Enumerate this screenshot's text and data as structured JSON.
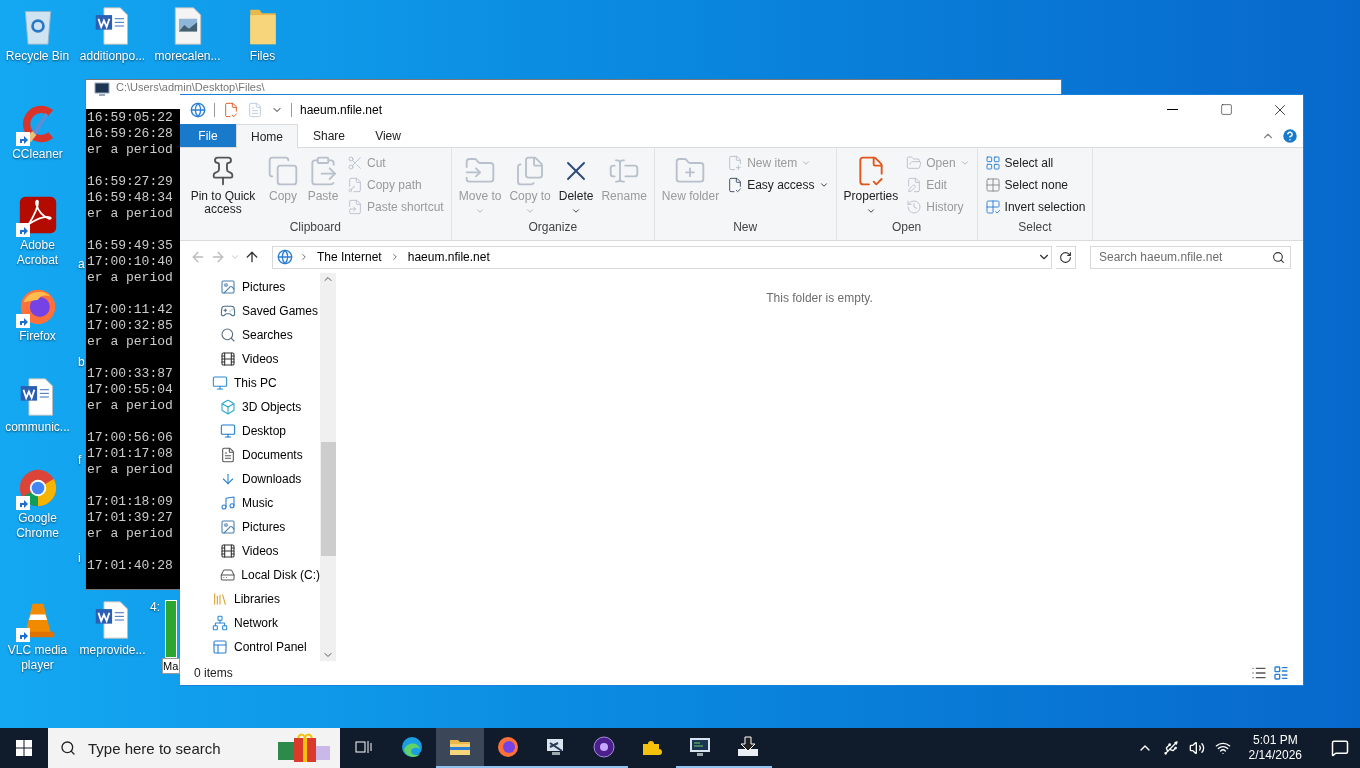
{
  "desktop": {
    "top_row": [
      {
        "label": "Recycle Bin",
        "kind": "recycle",
        "shortcut": false
      },
      {
        "label": "additionpo...",
        "kind": "word",
        "shortcut": false
      },
      {
        "label": "morecalen...",
        "kind": "image",
        "shortcut": false
      },
      {
        "label": "Files",
        "kind": "folder",
        "shortcut": false
      }
    ],
    "left_column": [
      {
        "label": "CCleaner",
        "kind": "ccleaner",
        "shortcut": true
      },
      {
        "label": "Adobe Acrobat",
        "kind": "acrobat",
        "shortcut": true
      },
      {
        "label": "Firefox",
        "kind": "firefox",
        "shortcut": true
      },
      {
        "label": "communic...",
        "kind": "word",
        "shortcut": false
      },
      {
        "label": "Google Chrome",
        "kind": "chrome",
        "shortcut": true
      }
    ],
    "bottom_row": [
      {
        "label": "VLC media player",
        "kind": "vlc",
        "shortcut": true
      },
      {
        "label": "meprovide...",
        "kind": "word",
        "shortcut": false
      },
      {
        "label": "4:",
        "kind": "covered"
      }
    ],
    "covered_labels": [
      "a",
      "b",
      "f",
      "i"
    ]
  },
  "back_window": {
    "label": "Ma"
  },
  "console": {
    "title": "C:\\Users\\admin\\Desktop\\Files\\",
    "blocks": [
      [
        "16:59:05:22",
        "16:59:26:28",
        "er a period"
      ],
      [
        "16:59:27:29",
        "16:59:48:34",
        "er a period"
      ],
      [
        "16:59:49:35",
        "17:00:10:40",
        "er a period"
      ],
      [
        "17:00:11:42",
        "17:00:32:85",
        "er a period"
      ],
      [
        "17:00:33:87",
        "17:00:55:04",
        "er a period"
      ],
      [
        "17:00:56:06",
        "17:01:17:08",
        "er a period"
      ],
      [
        "17:01:18:09",
        "17:01:39:27",
        "er a period"
      ],
      [
        "17:01:40:28"
      ]
    ]
  },
  "explorer": {
    "title": "haeum.nfile.net",
    "tabs": [
      {
        "label": "File",
        "kind": "menu",
        "selected": false
      },
      {
        "label": "Home",
        "kind": "tab",
        "selected": true
      },
      {
        "label": "Share",
        "kind": "tab",
        "selected": false
      },
      {
        "label": "View",
        "kind": "tab",
        "selected": false
      }
    ],
    "ribbon": [
      {
        "label": "Clipboard",
        "buttons": [
          {
            "label": "Pin to Quick access",
            "kind": "large",
            "disabled": false,
            "dropdown": false
          },
          {
            "label": "Copy",
            "kind": "large",
            "disabled": true,
            "dropdown": false
          },
          {
            "label": "Paste",
            "kind": "large",
            "disabled": true,
            "dropdown": false
          },
          {
            "label": "Cut",
            "kind": "small",
            "disabled": true,
            "dropdown": false
          },
          {
            "label": "Copy path",
            "kind": "small",
            "disabled": true,
            "dropdown": false
          },
          {
            "label": "Paste shortcut",
            "kind": "small",
            "disabled": true,
            "dropdown": false
          }
        ]
      },
      {
        "label": "Organize",
        "buttons": [
          {
            "label": "Move to",
            "kind": "large",
            "disabled": true,
            "dropdown": true
          },
          {
            "label": "Copy to",
            "kind": "large",
            "disabled": true,
            "dropdown": true
          },
          {
            "label": "Delete",
            "kind": "large",
            "disabled": false,
            "dropdown": true
          },
          {
            "label": "Rename",
            "kind": "large",
            "disabled": true,
            "dropdown": false
          }
        ]
      },
      {
        "label": "New",
        "buttons": [
          {
            "label": "New folder",
            "kind": "large",
            "disabled": true,
            "dropdown": false
          },
          {
            "label": "New item",
            "kind": "small",
            "disabled": true,
            "dropdown": true
          },
          {
            "label": "Easy access",
            "kind": "small",
            "disabled": false,
            "dropdown": true
          }
        ]
      },
      {
        "label": "Open",
        "buttons": [
          {
            "label": "Properties",
            "kind": "large",
            "disabled": false,
            "dropdown": true
          },
          {
            "label": "Open",
            "kind": "small",
            "disabled": true,
            "dropdown": true
          },
          {
            "label": "Edit",
            "kind": "small",
            "disabled": true,
            "dropdown": false
          },
          {
            "label": "History",
            "kind": "small",
            "disabled": true,
            "dropdown": false
          }
        ]
      },
      {
        "label": "Select",
        "buttons": [
          {
            "label": "Select all",
            "kind": "small",
            "disabled": false,
            "dropdown": false
          },
          {
            "label": "Select none",
            "kind": "small",
            "disabled": false,
            "dropdown": false
          },
          {
            "label": "Invert selection",
            "kind": "small",
            "disabled": false,
            "dropdown": false
          }
        ]
      }
    ],
    "address": [
      "The Internet",
      "haeum.nfile.net"
    ],
    "search": {
      "placeholder": "Search haeum.nfile.net"
    },
    "nav": [
      {
        "children": [
          {
            "label": "Pictures",
            "kind": "pictures"
          },
          {
            "label": "Saved Games",
            "kind": "games"
          },
          {
            "label": "Searches",
            "kind": "search"
          },
          {
            "label": "Videos",
            "kind": "videos"
          }
        ]
      },
      {
        "label": "This PC",
        "kind": "pc",
        "children": [
          {
            "label": "3D Objects",
            "kind": "objects"
          },
          {
            "label": "Desktop",
            "kind": "desktop"
          },
          {
            "label": "Documents",
            "kind": "documents"
          },
          {
            "label": "Downloads",
            "kind": "downloads"
          },
          {
            "label": "Music",
            "kind": "music"
          },
          {
            "label": "Pictures",
            "kind": "pictures"
          },
          {
            "label": "Videos",
            "kind": "videos"
          },
          {
            "label": "Local Disk (C:)",
            "kind": "disk"
          }
        ]
      },
      {
        "label": "Libraries",
        "kind": "libraries"
      },
      {
        "label": "Network",
        "kind": "network"
      },
      {
        "label": "Control Panel",
        "kind": "control"
      }
    ],
    "empty_message": "This folder is empty.",
    "status": "0 items"
  },
  "taskbar": {
    "search": {
      "placeholder": "Type here to search"
    },
    "apps": [
      {
        "kind": "edge",
        "selected": false,
        "open": false
      },
      {
        "kind": "explorer",
        "selected": true,
        "open": true
      },
      {
        "kind": "firefox",
        "selected": false,
        "open": true
      },
      {
        "kind": "monitor",
        "selected": false,
        "open": true
      },
      {
        "kind": "purple",
        "selected": false,
        "open": true
      },
      {
        "kind": "puzzle",
        "selected": false,
        "open": false
      },
      {
        "kind": "console",
        "selected": false,
        "open": true
      },
      {
        "kind": "install",
        "selected": false,
        "open": true
      }
    ],
    "time": "5:01 PM",
    "date": "2/14/2026"
  }
}
